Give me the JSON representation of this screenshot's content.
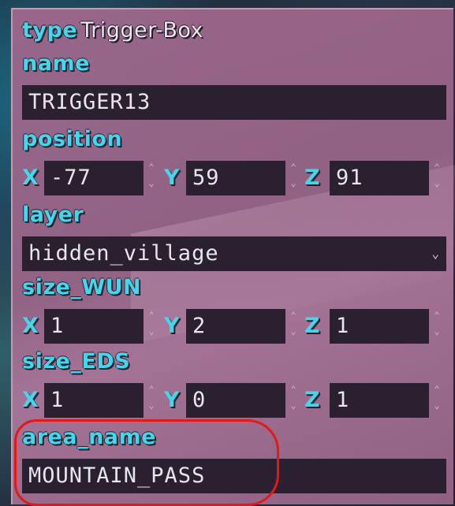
{
  "type_row": {
    "label": "type",
    "value": "Trigger-Box"
  },
  "name": {
    "label": "name",
    "value": "TRIGGER13"
  },
  "position": {
    "label": "position",
    "x": {
      "axis": "X",
      "value": "-77"
    },
    "y": {
      "axis": "Y",
      "value": "59"
    },
    "z": {
      "axis": "Z",
      "value": "91"
    }
  },
  "layer": {
    "label": "layer",
    "value": "hidden_village"
  },
  "size_wun": {
    "label": "size_WUN",
    "x": {
      "axis": "X",
      "value": "1"
    },
    "y": {
      "axis": "Y",
      "value": "2"
    },
    "z": {
      "axis": "Z",
      "value": "1"
    }
  },
  "size_eds": {
    "label": "size_EDS",
    "x": {
      "axis": "X",
      "value": "1"
    },
    "y": {
      "axis": "Y",
      "value": "0"
    },
    "z": {
      "axis": "Z",
      "value": "1"
    }
  },
  "area_name": {
    "label": "area_name",
    "value": "MOUNTAIN_PASS"
  },
  "icons": {
    "spinner": "up-down-spinner-icon",
    "dropdown": "chevron-down-icon"
  },
  "colors": {
    "label": "#41d8ee",
    "panel": "#9a6689",
    "field": "#2a2030",
    "highlight": "#e41818"
  }
}
